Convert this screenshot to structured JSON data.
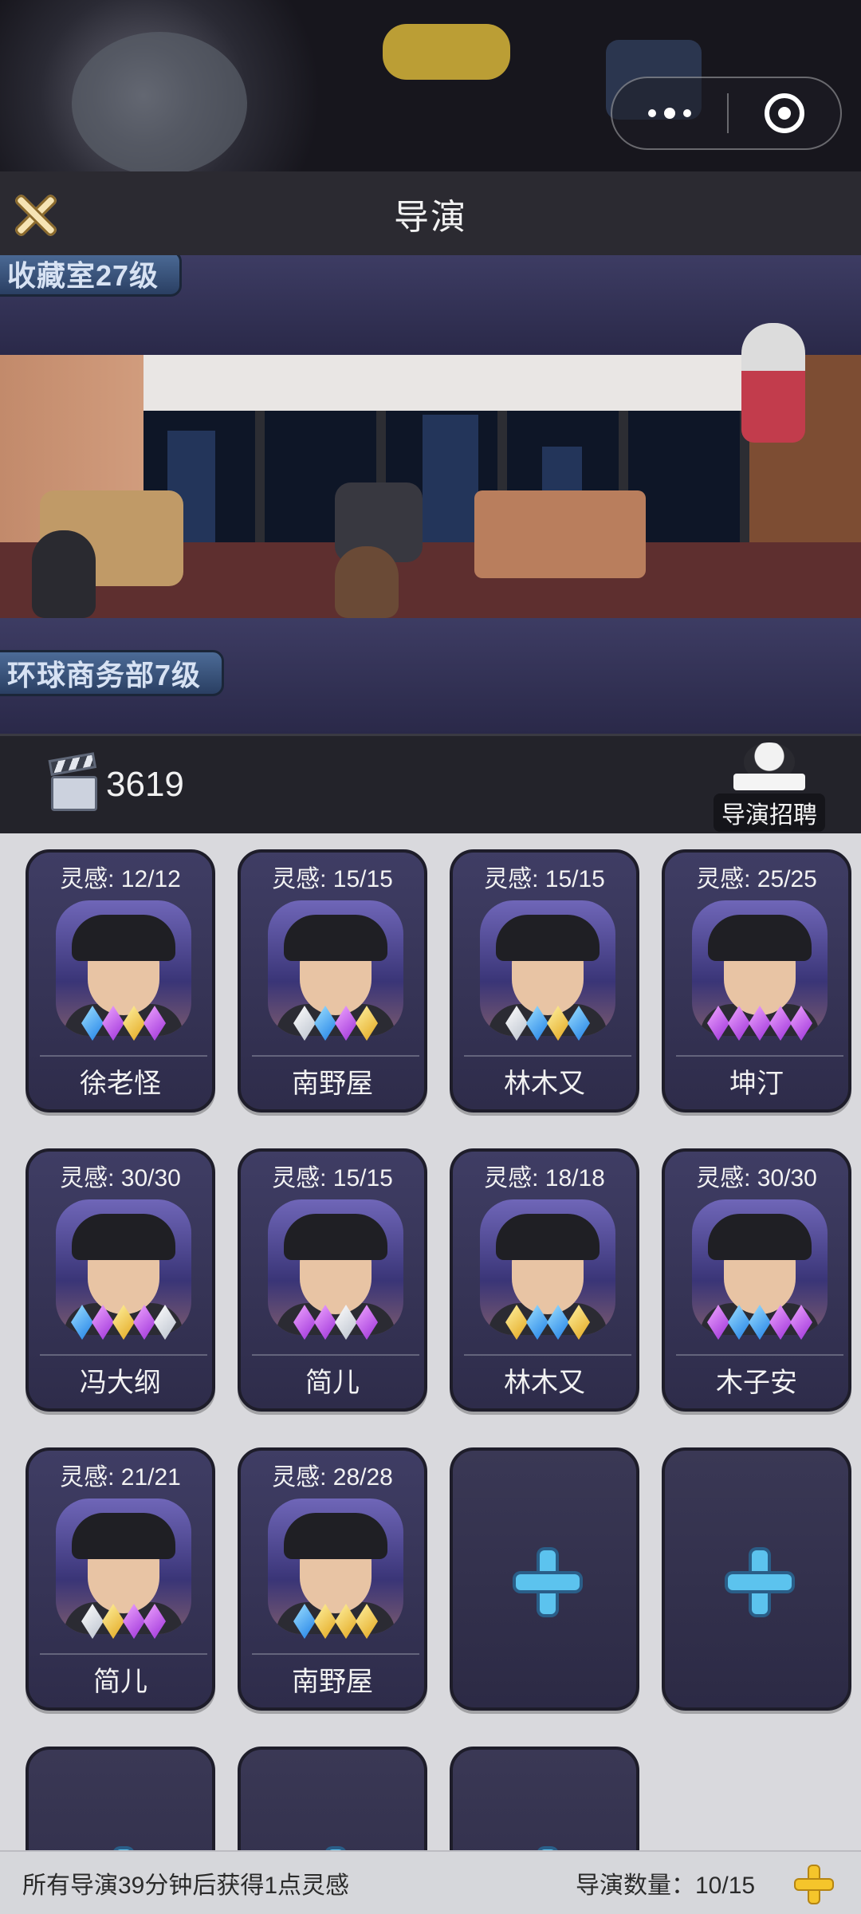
{
  "header": {
    "title": "导演"
  },
  "building": {
    "sign_top": "收藏室27级",
    "sign_mid": "环球商务部7级"
  },
  "panel": {
    "score": "3619",
    "recruit_label": "导演招聘"
  },
  "cards": [
    {
      "insp": "灵感: 12/12",
      "name": "徐老怪",
      "gems": [
        "blue",
        "purple",
        "gold",
        "purple"
      ]
    },
    {
      "insp": "灵感: 15/15",
      "name": "南野屋",
      "gems": [
        "white",
        "blue",
        "purple",
        "gold"
      ]
    },
    {
      "insp": "灵感: 15/15",
      "name": "林木又",
      "gems": [
        "white",
        "blue",
        "gold",
        "blue"
      ]
    },
    {
      "insp": "灵感: 25/25",
      "name": "坤汀",
      "gems": [
        "purple",
        "purple",
        "purple",
        "purple",
        "purple"
      ]
    },
    {
      "insp": "灵感: 30/30",
      "name": "冯大纲",
      "gems": [
        "blue",
        "purple",
        "gold",
        "purple",
        "white"
      ]
    },
    {
      "insp": "灵感: 15/15",
      "name": "简儿",
      "gems": [
        "purple",
        "purple",
        "white",
        "purple"
      ]
    },
    {
      "insp": "灵感: 18/18",
      "name": "林木又",
      "gems": [
        "gold",
        "blue",
        "blue",
        "gold"
      ]
    },
    {
      "insp": "灵感: 30/30",
      "name": "木子安",
      "gems": [
        "purple",
        "blue",
        "blue",
        "purple",
        "purple"
      ]
    },
    {
      "insp": "灵感: 21/21",
      "name": "简儿",
      "gems": [
        "white",
        "gold",
        "purple",
        "purple"
      ]
    },
    {
      "insp": "灵感: 28/28",
      "name": "南野屋",
      "gems": [
        "blue",
        "gold",
        "gold",
        "gold"
      ]
    }
  ],
  "footer": {
    "notice": "所有导演39分钟后获得1点灵感",
    "count": "导演数量：10/15"
  }
}
